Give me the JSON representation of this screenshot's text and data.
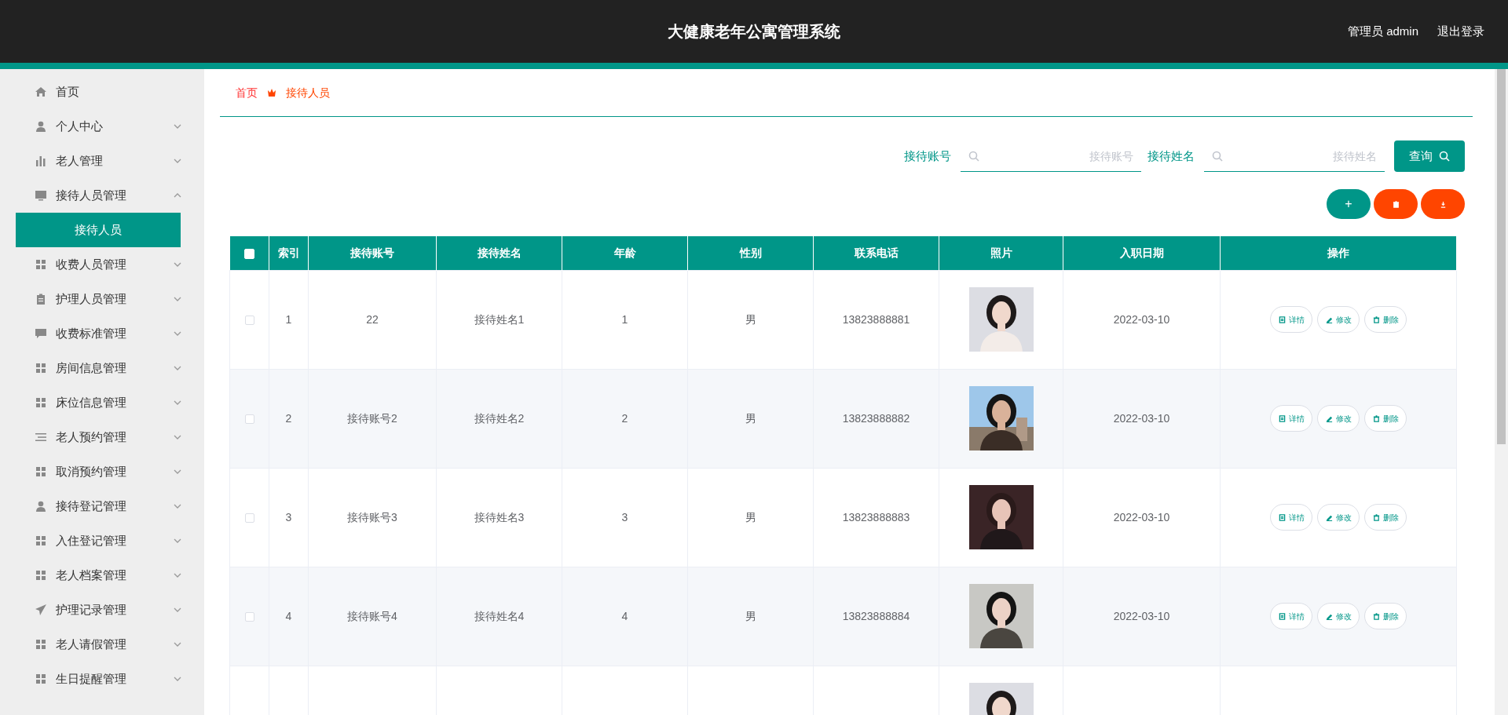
{
  "header": {
    "title": "大健康老年公寓管理系统",
    "user": "管理员 admin",
    "logout": "退出登录"
  },
  "sidebar": {
    "items": [
      {
        "label": "首页",
        "kind": "home"
      },
      {
        "label": "个人中心",
        "kind": "user",
        "expanded": false
      },
      {
        "label": "老人管理",
        "kind": "chart",
        "expanded": false
      },
      {
        "label": "接待人员管理",
        "kind": "monitor",
        "expanded": true,
        "children": [
          {
            "label": "接待人员",
            "selected": true
          }
        ]
      },
      {
        "label": "收费人员管理",
        "kind": "grid",
        "expanded": false
      },
      {
        "label": "护理人员管理",
        "kind": "clipboard",
        "expanded": false
      },
      {
        "label": "收费标准管理",
        "kind": "chat",
        "expanded": false
      },
      {
        "label": "房间信息管理",
        "kind": "grid",
        "expanded": false
      },
      {
        "label": "床位信息管理",
        "kind": "grid",
        "expanded": false
      },
      {
        "label": "老人预约管理",
        "kind": "list",
        "expanded": false
      },
      {
        "label": "取消预约管理",
        "kind": "grid",
        "expanded": false
      },
      {
        "label": "接待登记管理",
        "kind": "user",
        "expanded": false
      },
      {
        "label": "入住登记管理",
        "kind": "grid",
        "expanded": false
      },
      {
        "label": "老人档案管理",
        "kind": "grid",
        "expanded": false
      },
      {
        "label": "护理记录管理",
        "kind": "send",
        "expanded": false
      },
      {
        "label": "老人请假管理",
        "kind": "grid",
        "expanded": false
      },
      {
        "label": "生日提醒管理",
        "kind": "grid",
        "expanded": false
      }
    ]
  },
  "breadcrumb": [
    "首页",
    "接待人员"
  ],
  "search": {
    "fields": [
      {
        "label": "接待账号",
        "placeholder": "接待账号"
      },
      {
        "label": "接待姓名",
        "placeholder": "接待姓名"
      }
    ],
    "button": "查询"
  },
  "toolbar": [
    {
      "kind": "add",
      "label": "+"
    },
    {
      "kind": "delete"
    },
    {
      "kind": "export"
    }
  ],
  "table": {
    "select_all": {
      "checked": false
    },
    "columns": [
      "索引",
      "接待账号",
      "接待姓名",
      "年龄",
      "性别",
      "联系电话",
      "照片",
      "入职日期",
      "操作"
    ],
    "rows": [
      {
        "checked": false,
        "cells": [
          "1",
          "22",
          "接待姓名1",
          "1",
          "男",
          "13823888881"
        ],
        "photo": {
          "kind": "picture"
        },
        "date": "2022-03-10",
        "actions": [
          "详情",
          "修改",
          "删除"
        ]
      },
      {
        "checked": false,
        "cells": [
          "2",
          "接待账号2",
          "接待姓名2",
          "2",
          "男",
          "13823888882"
        ],
        "photo": {
          "kind": "picture"
        },
        "date": "2022-03-10",
        "actions": [
          "详情",
          "修改",
          "删除"
        ]
      },
      {
        "checked": false,
        "cells": [
          "3",
          "接待账号3",
          "接待姓名3",
          "3",
          "男",
          "13823888883"
        ],
        "photo": {
          "kind": "picture"
        },
        "date": "2022-03-10",
        "actions": [
          "详情",
          "修改",
          "删除"
        ]
      },
      {
        "checked": false,
        "cells": [
          "4",
          "接待账号4",
          "接待姓名4",
          "4",
          "男",
          "13823888884"
        ],
        "photo": {
          "kind": "picture"
        },
        "date": "2022-03-10",
        "actions": [
          "详情",
          "修改",
          "删除"
        ]
      }
    ],
    "cut_off_row": {
      "photo": {
        "kind": "picture"
      }
    }
  }
}
